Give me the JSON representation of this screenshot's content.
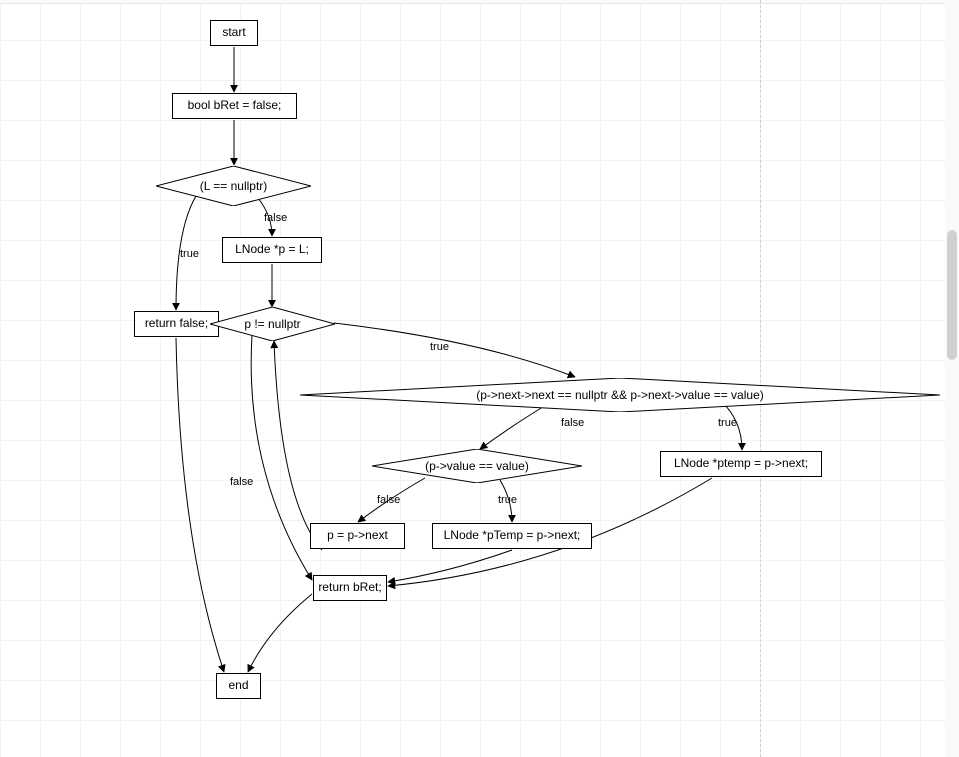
{
  "flowchart": {
    "nodes": {
      "start": {
        "label": "start"
      },
      "init": {
        "label": "bool bRet = false;"
      },
      "cond1": {
        "label": "(L == nullptr)"
      },
      "retFalse": {
        "label": "return false;"
      },
      "assignP": {
        "label": "LNode *p = L;"
      },
      "cond2": {
        "label": "p != nullptr"
      },
      "cond3": {
        "label": "(p->next->next == nullptr && p->next->value == value)"
      },
      "cond4": {
        "label": "(p->value == value)"
      },
      "pnext": {
        "label": "p = p->next"
      },
      "ptemp2": {
        "label": "LNode *pTemp = p->next;"
      },
      "ptemp1": {
        "label": "LNode *ptemp = p->next;"
      },
      "retbret": {
        "label": "return bRet;"
      },
      "end": {
        "label": "end"
      }
    },
    "edgeLabels": {
      "c1_true": "true",
      "c1_false": "false",
      "c2_true": "true",
      "c2_false": "false",
      "c3_true": "true",
      "c3_false": "false",
      "c4_true": "true",
      "c4_false": "false"
    }
  }
}
